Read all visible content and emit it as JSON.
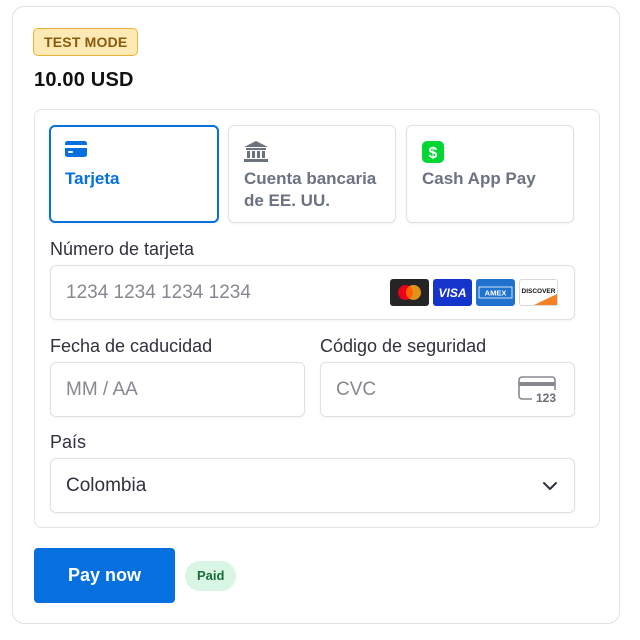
{
  "badge": "TEST MODE",
  "amount": "10.00 USD",
  "methods": [
    {
      "label": "Tarjeta",
      "icon": "credit-card-icon"
    },
    {
      "label": "Cuenta bancaria de EE. UU.",
      "icon": "bank-icon"
    },
    {
      "label": "Cash App Pay",
      "icon": "cash-app-icon"
    }
  ],
  "card_number": {
    "label": "Número de tarjeta",
    "placeholder": "1234 1234 1234 1234"
  },
  "card_brands": [
    "mastercard-icon",
    "visa-icon",
    "amex-icon",
    "discover-icon"
  ],
  "expiry": {
    "label": "Fecha de caducidad",
    "placeholder": "MM / AA"
  },
  "cvc": {
    "label": "Código de seguridad",
    "placeholder": "CVC",
    "icon_text": "123"
  },
  "country": {
    "label": "País",
    "value": "Colombia"
  },
  "pay_button": "Pay now",
  "status": "Paid",
  "colors": {
    "accent": "#0570de",
    "badge_bg": "#fde9b3",
    "paid_bg": "#d9f5e3"
  }
}
